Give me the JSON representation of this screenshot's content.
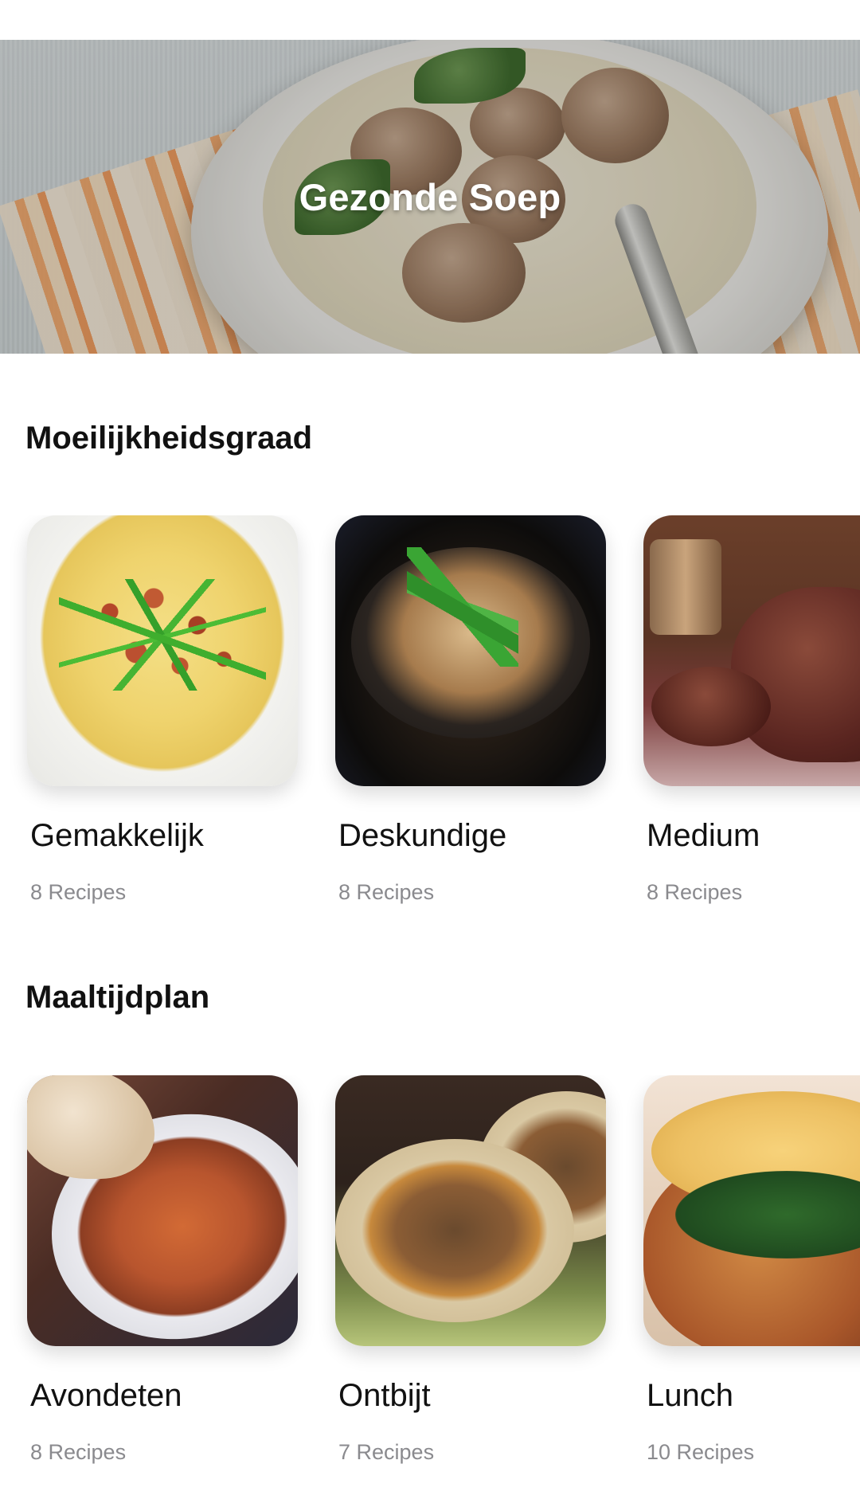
{
  "hero": {
    "title": "Gezonde Soep"
  },
  "sections": [
    {
      "title": "Moeilijkheidsgraad",
      "cards": [
        {
          "title": "Gemakkelijk",
          "subtitle": "8 Recipes"
        },
        {
          "title": "Deskundige",
          "subtitle": "8 Recipes"
        },
        {
          "title": "Medium",
          "subtitle": "8 Recipes"
        }
      ]
    },
    {
      "title": "Maaltijdplan",
      "cards": [
        {
          "title": "Avondeten",
          "subtitle": "8 Recipes"
        },
        {
          "title": "Ontbijt",
          "subtitle": "7 Recipes"
        },
        {
          "title": "Lunch",
          "subtitle": "10 Recipes"
        }
      ]
    }
  ],
  "colors": {
    "background": "#ffffff",
    "text_primary": "#111111",
    "text_secondary": "#8a8a8e",
    "hero_text": "#ffffff"
  },
  "icons": []
}
